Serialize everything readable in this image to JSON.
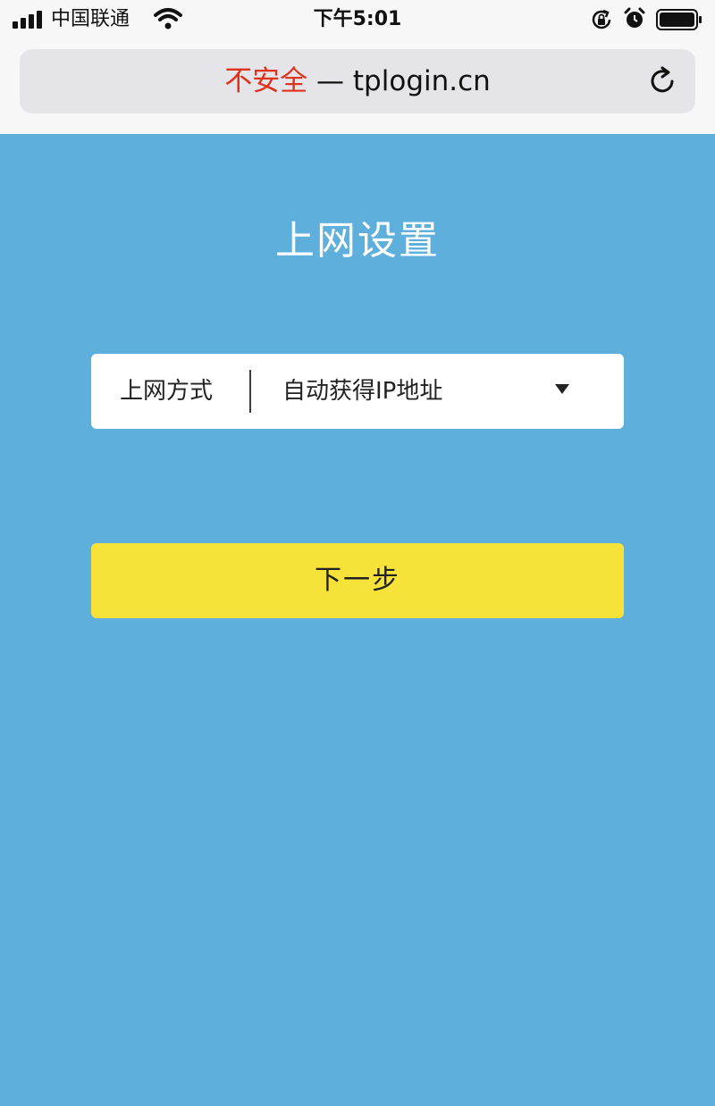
{
  "status_bar": {
    "carrier": "中国联通",
    "time": "下午5:01"
  },
  "address_bar": {
    "security_text": "不安全",
    "separator": "—",
    "url": "tplogin.cn"
  },
  "page": {
    "title": "上网设置",
    "connection_type": {
      "label": "上网方式",
      "selected_value": "自动获得IP地址"
    },
    "next_button_label": "下一步"
  },
  "colors": {
    "background": "#5fafdd",
    "button": "#f7e23a",
    "insecure_text": "#e0321b"
  },
  "icons": [
    "signal-icon",
    "wifi-icon",
    "rotation-lock-icon",
    "alarm-icon",
    "battery-icon",
    "reload-icon",
    "dropdown-arrow-icon"
  ]
}
